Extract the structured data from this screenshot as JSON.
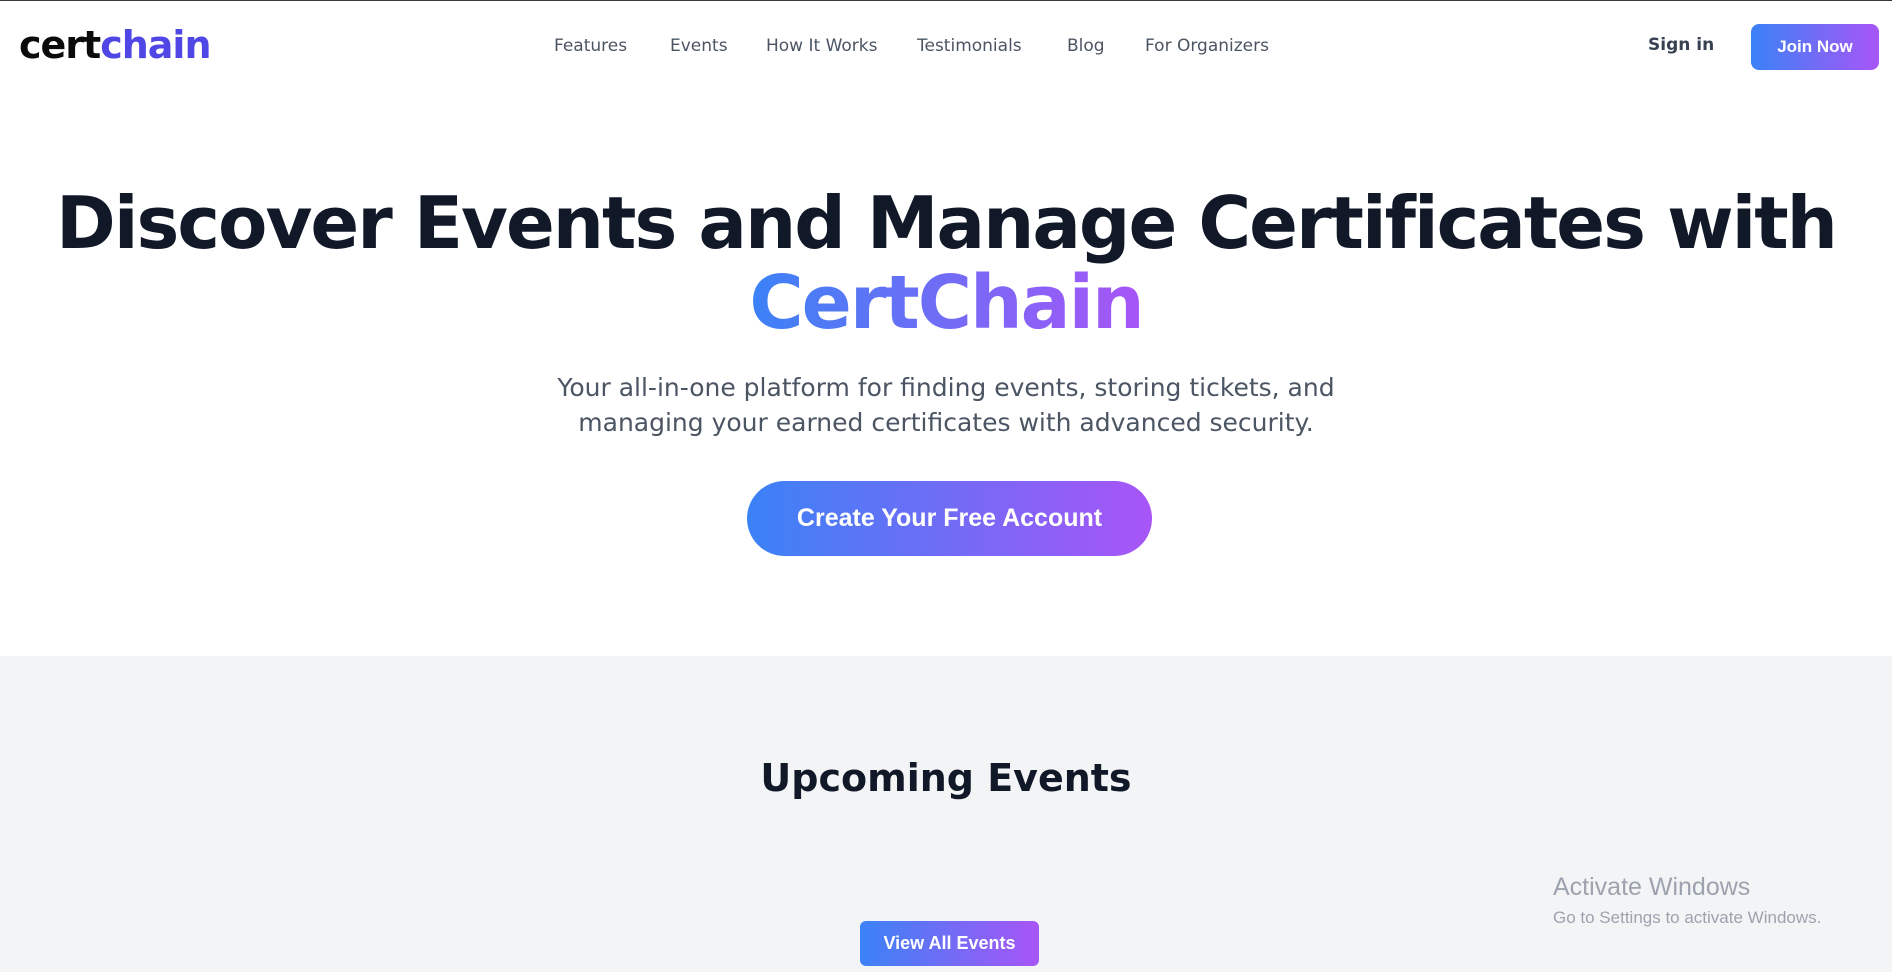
{
  "header": {
    "logo_part1": "cert",
    "logo_part2": "chain",
    "nav": [
      "Features",
      "Events",
      "How It Works",
      "Testimonials",
      "Blog",
      "For Organizers"
    ],
    "signin_label": "Sign in",
    "join_label": "Join Now"
  },
  "hero": {
    "title": "Discover Events and Manage Certificates with",
    "brand": "CertChain",
    "subtitle": "Your all-in-one platform for finding events, storing tickets, and managing your earned certificates with advanced security.",
    "cta_label": "Create Your Free Account"
  },
  "events": {
    "title": "Upcoming Events",
    "view_all_label": "View All Events"
  },
  "watermark": {
    "line1": "Activate Windows",
    "line2": "Go to Settings to activate Windows."
  },
  "colors": {
    "accent_start": "#3b82f6",
    "accent_end": "#a855f7",
    "logo_accent": "#4f46e5",
    "section_bg": "#f3f4f6"
  }
}
